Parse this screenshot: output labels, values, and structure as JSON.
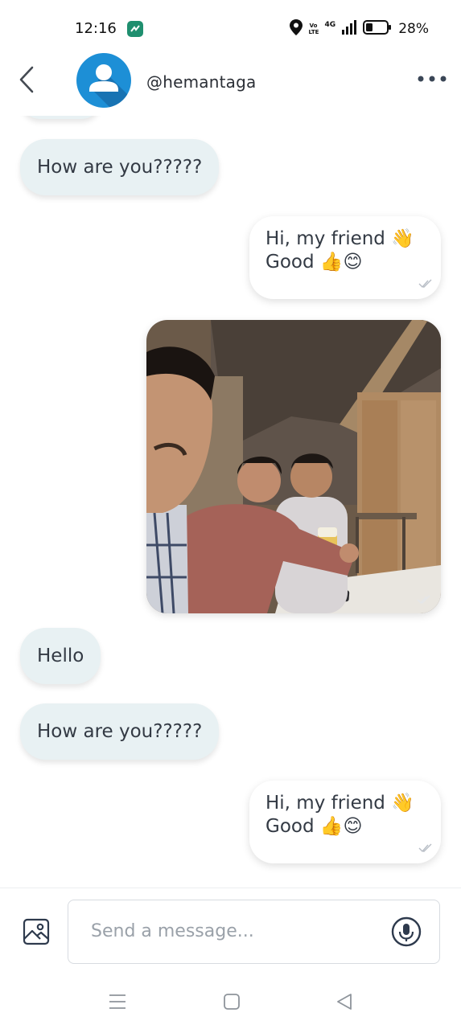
{
  "status_bar": {
    "time": "12:16",
    "volte_line1": "Vo",
    "volte_line2": "LTE",
    "network": "4G",
    "battery": "28%"
  },
  "header": {
    "username": "@hemantaga",
    "back_icon": "chevron-left-icon",
    "more_icon": "more-horizontal-icon",
    "avatar_icon": "user-silhouette-icon"
  },
  "messages": [
    {
      "type": "text",
      "direction": "incoming",
      "text": "How are you?????"
    },
    {
      "type": "text",
      "direction": "outgoing",
      "lines": [
        "Hi, my friend 👋",
        "Good 👍😊"
      ],
      "read": true
    },
    {
      "type": "image",
      "direction": "outgoing",
      "read": true
    },
    {
      "type": "text",
      "direction": "incoming",
      "text": "Hello"
    },
    {
      "type": "text",
      "direction": "incoming",
      "text": "How are you?????"
    },
    {
      "type": "text",
      "direction": "outgoing",
      "lines": [
        "Hi, my friend 👋",
        "Good 👍😊"
      ],
      "read": true
    }
  ],
  "composer": {
    "placeholder": "Send a message...",
    "value": "",
    "gallery_icon": "image-icon",
    "mic_icon": "microphone-icon"
  },
  "nav": {
    "icons": [
      "menu-icon",
      "home-square-icon",
      "back-triangle-icon"
    ]
  },
  "colors": {
    "incoming_bubble": "#e8f1f3",
    "outgoing_bubble": "#ffffff",
    "avatar": "#1d8fd6",
    "text": "#333a44"
  }
}
